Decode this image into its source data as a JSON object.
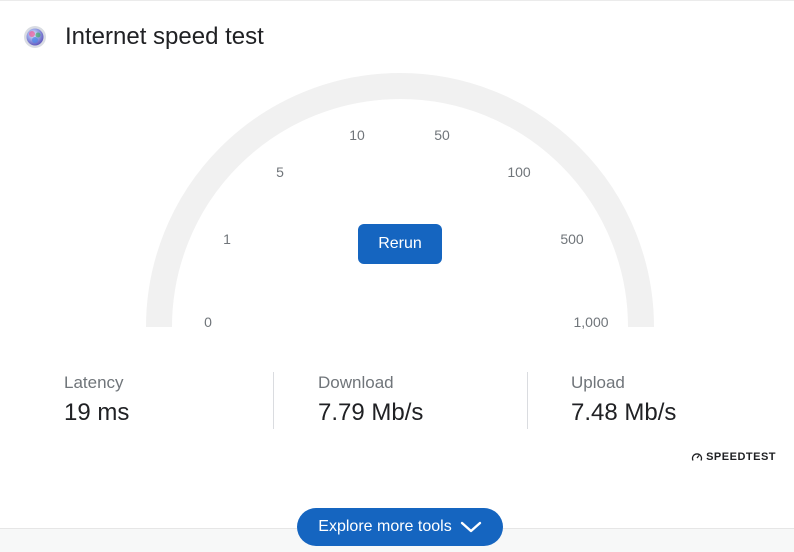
{
  "header": {
    "title": "Internet speed test",
    "icon": "speed-test-globe-icon"
  },
  "gauge": {
    "ticks": [
      "0",
      "1",
      "5",
      "10",
      "50",
      "100",
      "500",
      "1,000"
    ],
    "track_color": "#f1f1f1"
  },
  "rerun_label": "Rerun",
  "stats": [
    {
      "label": "Latency",
      "value": "19 ms"
    },
    {
      "label": "Download",
      "value": "7.79 Mb/s"
    },
    {
      "label": "Upload",
      "value": "7.48 Mb/s"
    }
  ],
  "brand": {
    "label": "SPEEDTEST",
    "icon": "speedometer-icon"
  },
  "explore": {
    "label": "Explore more tools",
    "icon": "chevron-down-icon"
  },
  "colors": {
    "accent": "#1565c0",
    "text": "#202124",
    "muted": "#70757a"
  }
}
